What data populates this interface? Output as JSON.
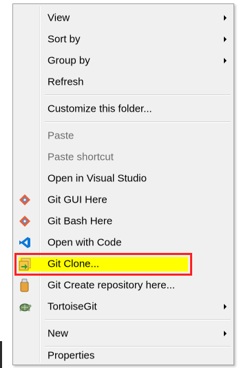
{
  "menu": {
    "items": [
      {
        "label": "View",
        "submenu": true
      },
      {
        "label": "Sort by",
        "submenu": true
      },
      {
        "label": "Group by",
        "submenu": true
      },
      {
        "label": "Refresh"
      },
      {
        "label": "Customize this folder..."
      },
      {
        "label": "Paste",
        "disabled": true
      },
      {
        "label": "Paste shortcut",
        "disabled": true
      },
      {
        "label": "Open in Visual Studio"
      },
      {
        "label": "Git GUI Here",
        "icon": "git-gui-icon"
      },
      {
        "label": "Git Bash Here",
        "icon": "git-bash-icon"
      },
      {
        "label": "Open with Code",
        "icon": "vscode-icon"
      },
      {
        "label": "Git Clone...",
        "icon": "git-clone-icon",
        "highlighted": true
      },
      {
        "label": "Git Create repository here...",
        "icon": "git-create-repo-icon"
      },
      {
        "label": "TortoiseGit",
        "icon": "tortoisegit-icon",
        "submenu": true
      },
      {
        "label": "New",
        "submenu": true
      },
      {
        "label": "Properties"
      }
    ]
  },
  "colors": {
    "highlight_fill": "#ffff00",
    "highlight_border": "#ff2020",
    "menu_bg": "#f0f0f0",
    "disabled_text": "#6d6d6d"
  }
}
